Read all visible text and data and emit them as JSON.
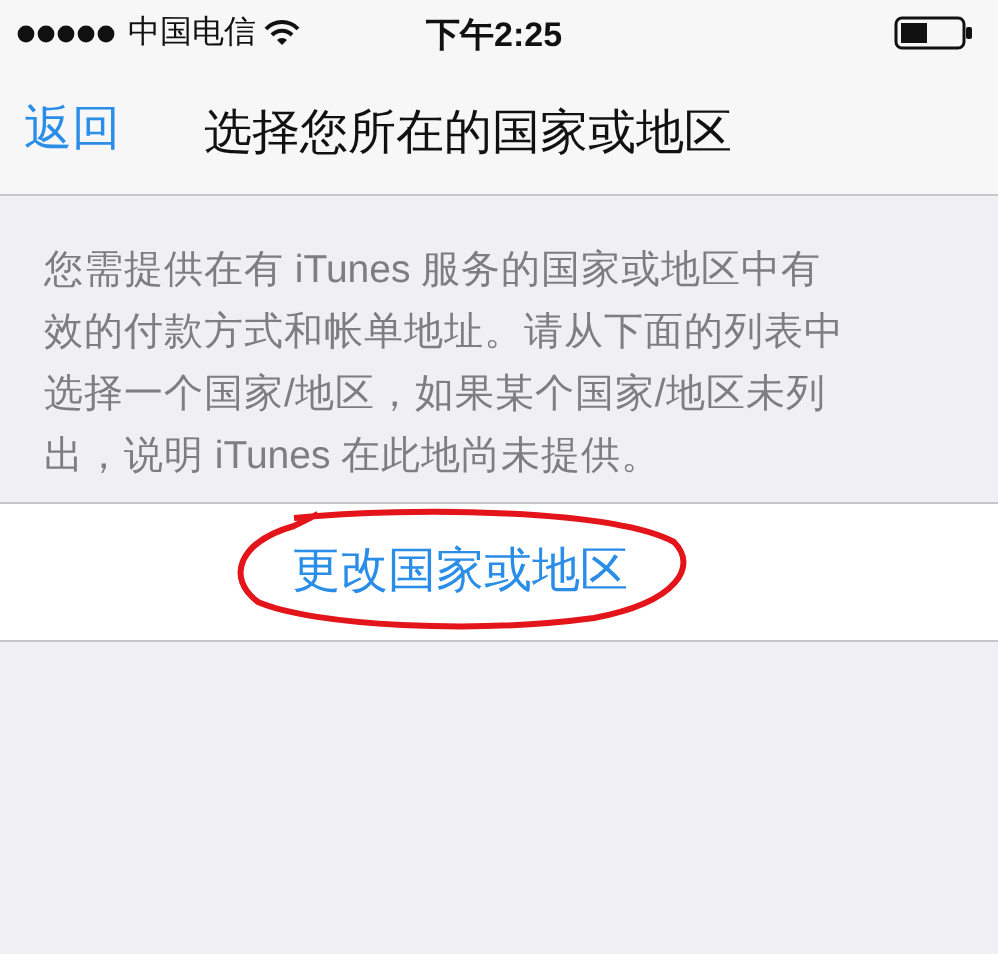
{
  "status_bar": {
    "carrier": "中国电信",
    "time": "下午2:25"
  },
  "nav_bar": {
    "back": "返回",
    "title": "选择您所在的国家或地区"
  },
  "description_lines": [
    "您需提供在有 iTunes 服务的国家或地区中有",
    "效的付款方式和帐单地址。请从下面的列表中",
    "选择一个国家/地区，如果某个国家/地区未列",
    "出，说明 iTunes 在此地尚未提供。"
  ],
  "action": {
    "label": "更改国家或地区",
    "circled": true
  }
}
